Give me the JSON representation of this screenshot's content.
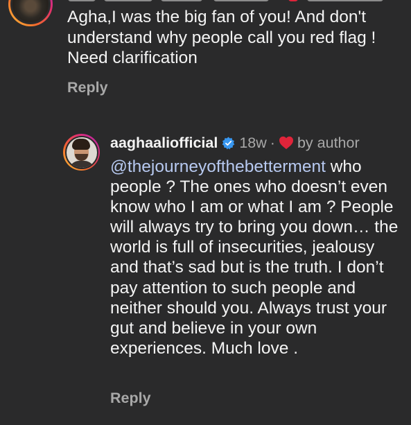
{
  "parent_comment": {
    "text": "Agha,I was the big fan of you! And don't\nunderstand why people call you red flag !\nNeed clarification",
    "reply_label": "Reply"
  },
  "reply_comment": {
    "username": "aaghaaliofficial",
    "time": "18w",
    "separator": "·",
    "liked_label": "by author",
    "mention": "@thejourneyofthebetterment",
    "body": " who people ? The ones who doesn’t even know who I am or what I am ? People will always try to bring you down… the world is full of insecurities, jealousy and that’s sad but is the truth. I don’t pay attention to such people and neither should you. Always trust your gut and believe in your own experiences. Much love .",
    "reply_label": "Reply"
  },
  "colors": {
    "background": "#2a2a2b",
    "text": "#f4f4f4",
    "muted": "#a8a8a8",
    "mention": "#b7c9f0",
    "verified": "#3897f0",
    "heart": "#e0243a"
  },
  "icons": {
    "verified": "verified-badge-icon",
    "liked": "heart-icon"
  }
}
